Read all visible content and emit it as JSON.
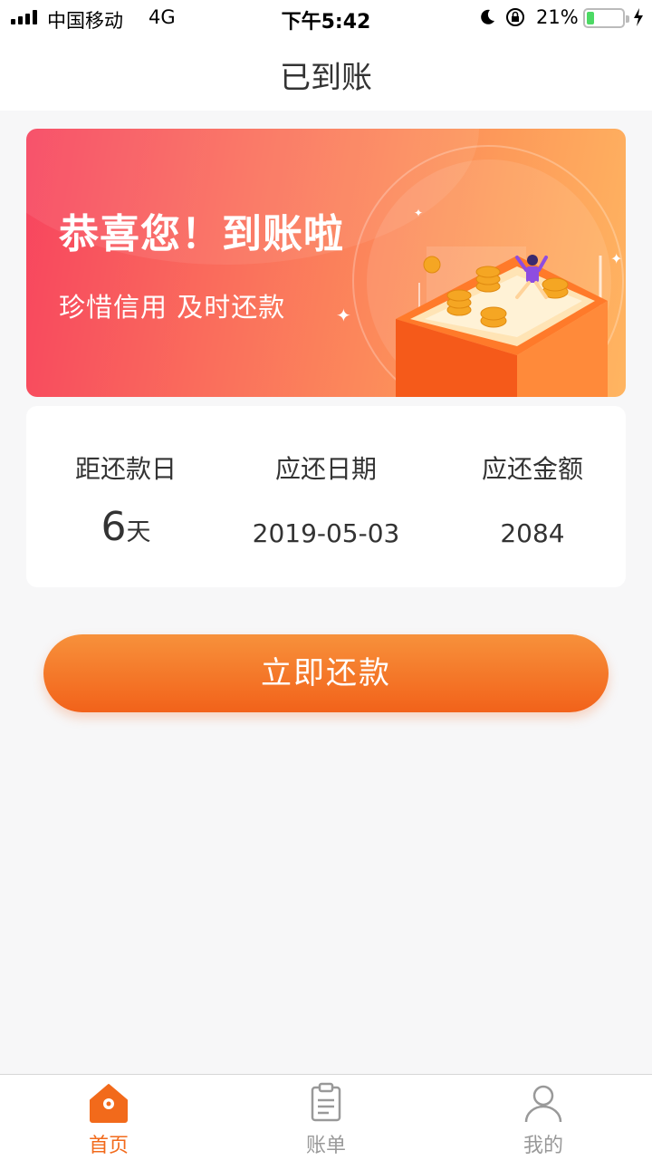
{
  "status_bar": {
    "carrier": "中国移动",
    "network": "4G",
    "time": "下午5:42",
    "battery_percent": "21%",
    "battery_level": 0.21,
    "icons": [
      "signal-icon",
      "moon-icon",
      "orientation-lock-icon",
      "battery-icon",
      "charging-icon"
    ]
  },
  "nav": {
    "title": "已到账"
  },
  "banner": {
    "title": "恭喜您！到账啦",
    "subtitle": "珍惜信用  及时还款",
    "colors": [
      "#f7445f",
      "#ffb561"
    ]
  },
  "repayment": {
    "days_label": "距还款日",
    "days_value": "6",
    "days_unit": "天",
    "due_date_label": "应还日期",
    "due_date_value": "2019-05-03",
    "amount_label": "应还金额",
    "amount_value": "2084"
  },
  "action": {
    "repay_label": "立即还款",
    "color": "#f2621a"
  },
  "tabbar": {
    "active_color": "#f26a1b",
    "inactive_color": "#999999",
    "items": [
      {
        "label": "首页",
        "icon": "home-icon",
        "active": true
      },
      {
        "label": "账单",
        "icon": "bill-icon",
        "active": false
      },
      {
        "label": "我的",
        "icon": "profile-icon",
        "active": false
      }
    ]
  }
}
